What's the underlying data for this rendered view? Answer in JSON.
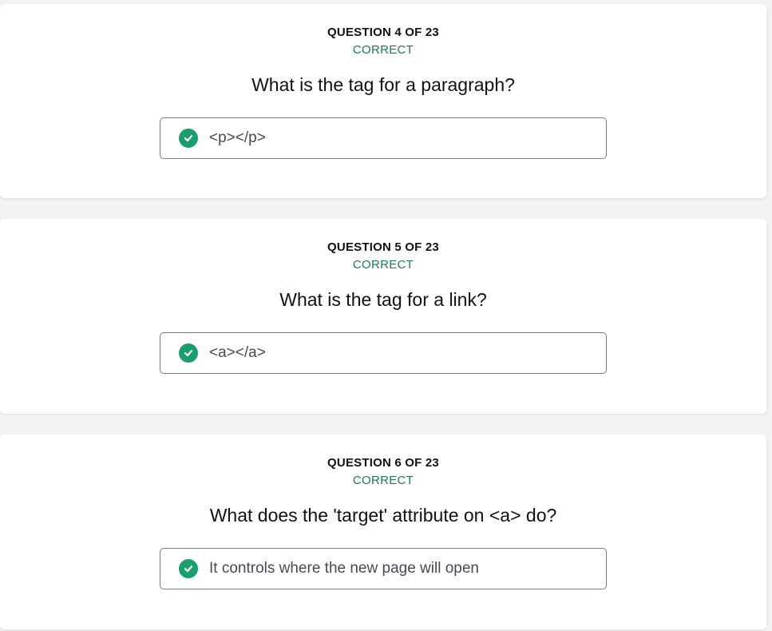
{
  "colors": {
    "correct_text": "#1d7a52",
    "check_badge": "#1b9e6e"
  },
  "questions": [
    {
      "counter": "QUESTION 4 OF 23",
      "status": "CORRECT",
      "text": "What is the tag for a paragraph?",
      "answer": "<p></p>",
      "answer_icon": "check-circle-icon"
    },
    {
      "counter": "QUESTION 5 OF 23",
      "status": "CORRECT",
      "text": "What is the tag for a link?",
      "answer": "<a></a>",
      "answer_icon": "check-circle-icon"
    },
    {
      "counter": "QUESTION 6 OF 23",
      "status": "CORRECT",
      "text": "What does the 'target' attribute on <a> do?",
      "answer": "It controls where the new page will open",
      "answer_icon": "check-circle-icon"
    }
  ]
}
